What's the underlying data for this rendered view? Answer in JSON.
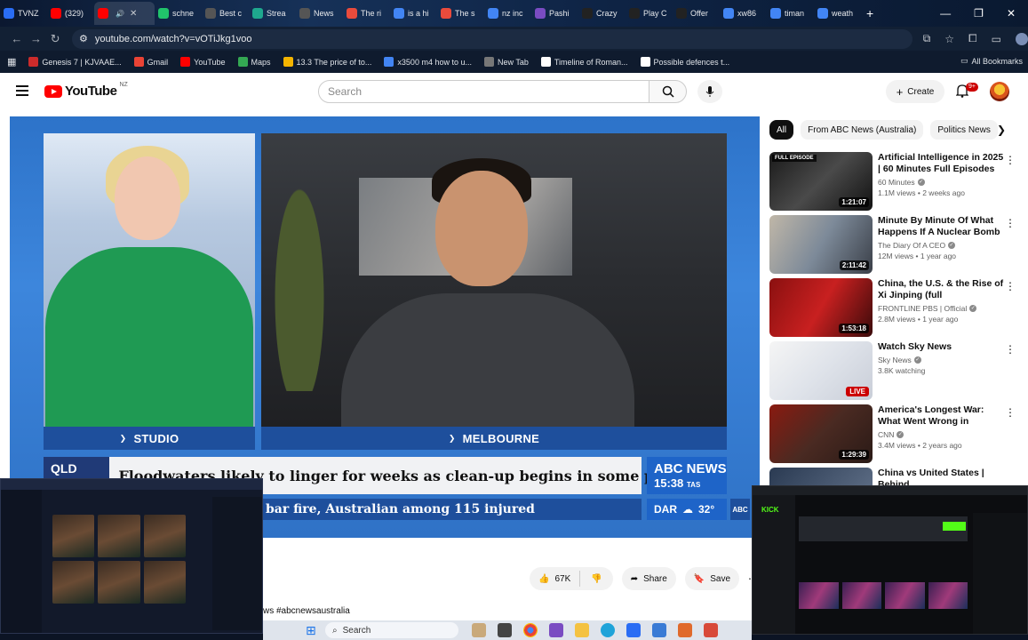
{
  "browser": {
    "tabs": [
      {
        "label": "TVNZ",
        "color": "#2a6df4"
      },
      {
        "label": "(329)",
        "color": "#ff0000"
      },
      {
        "label": "",
        "color": "#ff0000",
        "active": true
      },
      {
        "label": "schne",
        "color": "#21c36b"
      },
      {
        "label": "Best c",
        "color": "#555555"
      },
      {
        "label": "Strea",
        "color": "#1ea88e"
      },
      {
        "label": "News",
        "color": "#555555"
      },
      {
        "label": "The ri",
        "color": "#e94b3c"
      },
      {
        "label": "is a hi",
        "color": "#4285f4"
      },
      {
        "label": "The s",
        "color": "#e94b3c"
      },
      {
        "label": "nz inc",
        "color": "#4285f4"
      },
      {
        "label": "Pashi",
        "color": "#7a4cc2"
      },
      {
        "label": "Crazy",
        "color": "#222222"
      },
      {
        "label": "Play C",
        "color": "#222222"
      },
      {
        "label": "Offer",
        "color": "#222222"
      },
      {
        "label": "xw86",
        "color": "#4285f4"
      },
      {
        "label": "timan",
        "color": "#4285f4"
      },
      {
        "label": "weath",
        "color": "#4285f4"
      }
    ],
    "url": "youtube.com/watch?v=vOTiJkg1voo",
    "window_controls": [
      "—",
      "❐",
      "✕"
    ],
    "bookmarks": [
      {
        "label": "Genesis 7 | KJVAAE...",
        "color": "#cc2b2b"
      },
      {
        "label": "Gmail",
        "color": "#ea4335"
      },
      {
        "label": "YouTube",
        "color": "#ff0000"
      },
      {
        "label": "Maps",
        "color": "#34a853"
      },
      {
        "label": "13.3 The price of to...",
        "color": "#f4b400"
      },
      {
        "label": "x3500 m4 how to u...",
        "color": "#4285f4"
      },
      {
        "label": "New Tab",
        "color": "#777777"
      },
      {
        "label": "Timeline of Roman...",
        "color": "#ffffff"
      },
      {
        "label": "Possible defences t...",
        "color": "#ffffff"
      }
    ],
    "all_bookmarks": "All Bookmarks"
  },
  "youtube": {
    "logo": "YouTube",
    "region": "NZ",
    "search_placeholder": "Search",
    "create_label": "Create",
    "notif_count": "9+"
  },
  "video": {
    "left_location": "STUDIO",
    "right_location": "MELBOURNE",
    "ticker_tag": "QLD FLOODS",
    "ticker_headline": "Floodwaters likely to linger for weeks as clean-up begins in some parts",
    "ticker_sub": "bar fire, Australian among 115 injured",
    "brand": "ABC NEWS",
    "time": "15:38",
    "timezone": "TAS",
    "weather_city": "DAR",
    "weather_temp": "32°",
    "brand_small": "ABC"
  },
  "actions": {
    "likes": "67K",
    "share": "Share",
    "save": "Save"
  },
  "description_tag": "ws #abcnewsaustralia",
  "chips": [
    "All",
    "From ABC News (Australia)",
    "Politics News"
  ],
  "recommendations": [
    {
      "title": "Artificial Intelligence in 2025 | 60 Minutes Full Episodes",
      "channel": "60 Minutes",
      "meta": "1.1M views • 2 weeks ago",
      "duration": "1:21:07",
      "ribbon": "FULL EPISODE",
      "thumb": "linear-gradient(135deg,#1a1a1a,#4a4a4a 50%,#111)"
    },
    {
      "title": "Minute By Minute Of What Happens If A Nuclear Bomb ...",
      "channel": "The Diary Of A CEO",
      "meta": "12M views • 1 year ago",
      "duration": "2:11:42",
      "ribbon": "",
      "thumb": "linear-gradient(120deg,#c0b7a8,#7d8a99 50%,#3a3f48)"
    },
    {
      "title": "China, the U.S. & the Rise of Xi Jinping (full documentary) | ...",
      "channel": "FRONTLINE PBS | Official",
      "meta": "2.8M views • 1 year ago",
      "duration": "1:53:18",
      "ribbon": "",
      "thumb": "linear-gradient(120deg,#8a1010,#c82020 50%,#3a0a0a)"
    },
    {
      "title": "Watch Sky News",
      "channel": "Sky News",
      "meta": "3.8K watching",
      "duration": "LIVE",
      "ribbon": "",
      "thumb": "linear-gradient(135deg,#f5f5f5,#dfe3ea 50%,#c9ced8)"
    },
    {
      "title": "America's Longest War: What Went Wrong in Afghanistan ...",
      "channel": "CNN",
      "meta": "3.4M views • 2 years ago",
      "duration": "1:29:39",
      "ribbon": "",
      "thumb": "linear-gradient(135deg,#8a1a10,#4a2a22 50%,#2a1a16)"
    },
    {
      "title": "China vs United States | Behind",
      "channel": "",
      "meta": "",
      "duration": "",
      "ribbon": "",
      "thumb": "linear-gradient(135deg,#2a3a52,#6a7a92)"
    }
  ],
  "mini_right": {
    "logo": "KICK"
  },
  "taskbar": {
    "search": "Search"
  }
}
